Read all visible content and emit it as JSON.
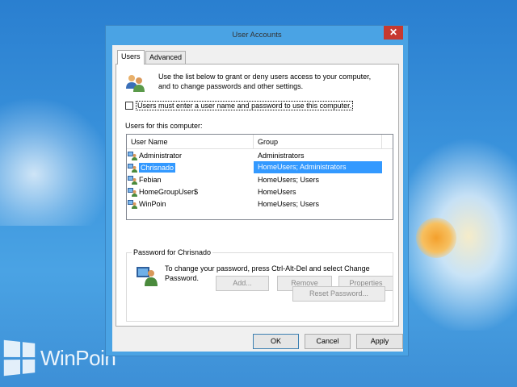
{
  "window": {
    "title": "User Accounts",
    "close_label": "✕"
  },
  "tabs": [
    {
      "label": "Users",
      "active": true
    },
    {
      "label": "Advanced",
      "active": false
    }
  ],
  "users_tab": {
    "intro_line1": "Use the list below to grant or deny users access to your computer,",
    "intro_line2": "and to change passwords and other settings.",
    "require_login_label": "Users must enter a user name and password to use this computer.",
    "require_login_checked": false,
    "list_label": "Users for this computer:",
    "columns": [
      "User Name",
      "Group"
    ],
    "rows": [
      {
        "name": "Administrator",
        "group": "Administrators",
        "selected": false
      },
      {
        "name": "Chrisnado",
        "group": "HomeUsers; Administrators",
        "selected": true
      },
      {
        "name": "Febian",
        "group": "HomeUsers; Users",
        "selected": false
      },
      {
        "name": "HomeGroupUser$",
        "group": "HomeUsers",
        "selected": false
      },
      {
        "name": "WinPoin",
        "group": "HomeUsers; Users",
        "selected": false
      }
    ],
    "buttons": {
      "add": "Add...",
      "remove": "Remove",
      "properties": "Properties"
    },
    "password_group": {
      "legend": "Password for Chrisnado",
      "text_line1": "To change your password, press Ctrl-Alt-Del and select Change",
      "text_line2": "Password.",
      "reset_button": "Reset Password..."
    }
  },
  "footer": {
    "ok": "OK",
    "cancel": "Cancel",
    "apply": "Apply"
  },
  "watermark": {
    "text": "WinPoin"
  },
  "colors": {
    "selection": "#3399ff",
    "close_button": "#c7392f",
    "desktop": "#3a93dc"
  }
}
